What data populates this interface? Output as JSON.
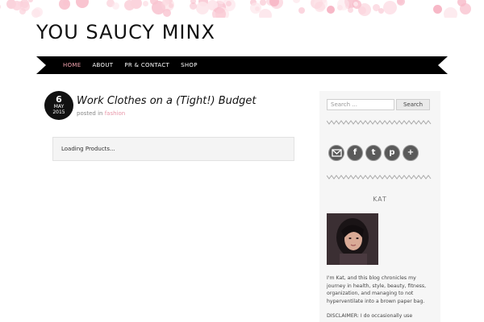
{
  "site": {
    "title": "YOU SAUCY MINX"
  },
  "nav": {
    "items": [
      {
        "label": "HOME",
        "active": true
      },
      {
        "label": "ABOUT",
        "active": false
      },
      {
        "label": "PR & CONTACT",
        "active": false
      },
      {
        "label": "SHOP",
        "active": false
      }
    ]
  },
  "post": {
    "date_day": "6",
    "date_month": "MAY",
    "date_year": "2015",
    "title": "Work Clothes on a (Tight!) Budget",
    "posted_in_prefix": "posted in ",
    "category": "fashion",
    "loading_text": "Loading Products..."
  },
  "sidebar": {
    "search_placeholder": "Search ...",
    "search_button": "Search",
    "social_icons": [
      "email-icon",
      "facebook-icon",
      "twitter-icon",
      "pinterest-icon",
      "plus-icon"
    ],
    "author_heading": "KAT",
    "bio": "I'm Kat, and this blog chronicles my journey in health, style, beauty, fitness, organization, and managing to not hyperventilate into a brown paper bag.",
    "disclaimer": "DISCLAIMER: I do occasionally use"
  },
  "colors": {
    "accent": "#f4a4b0",
    "nav_bg": "#000000",
    "link": "#e896a8"
  }
}
